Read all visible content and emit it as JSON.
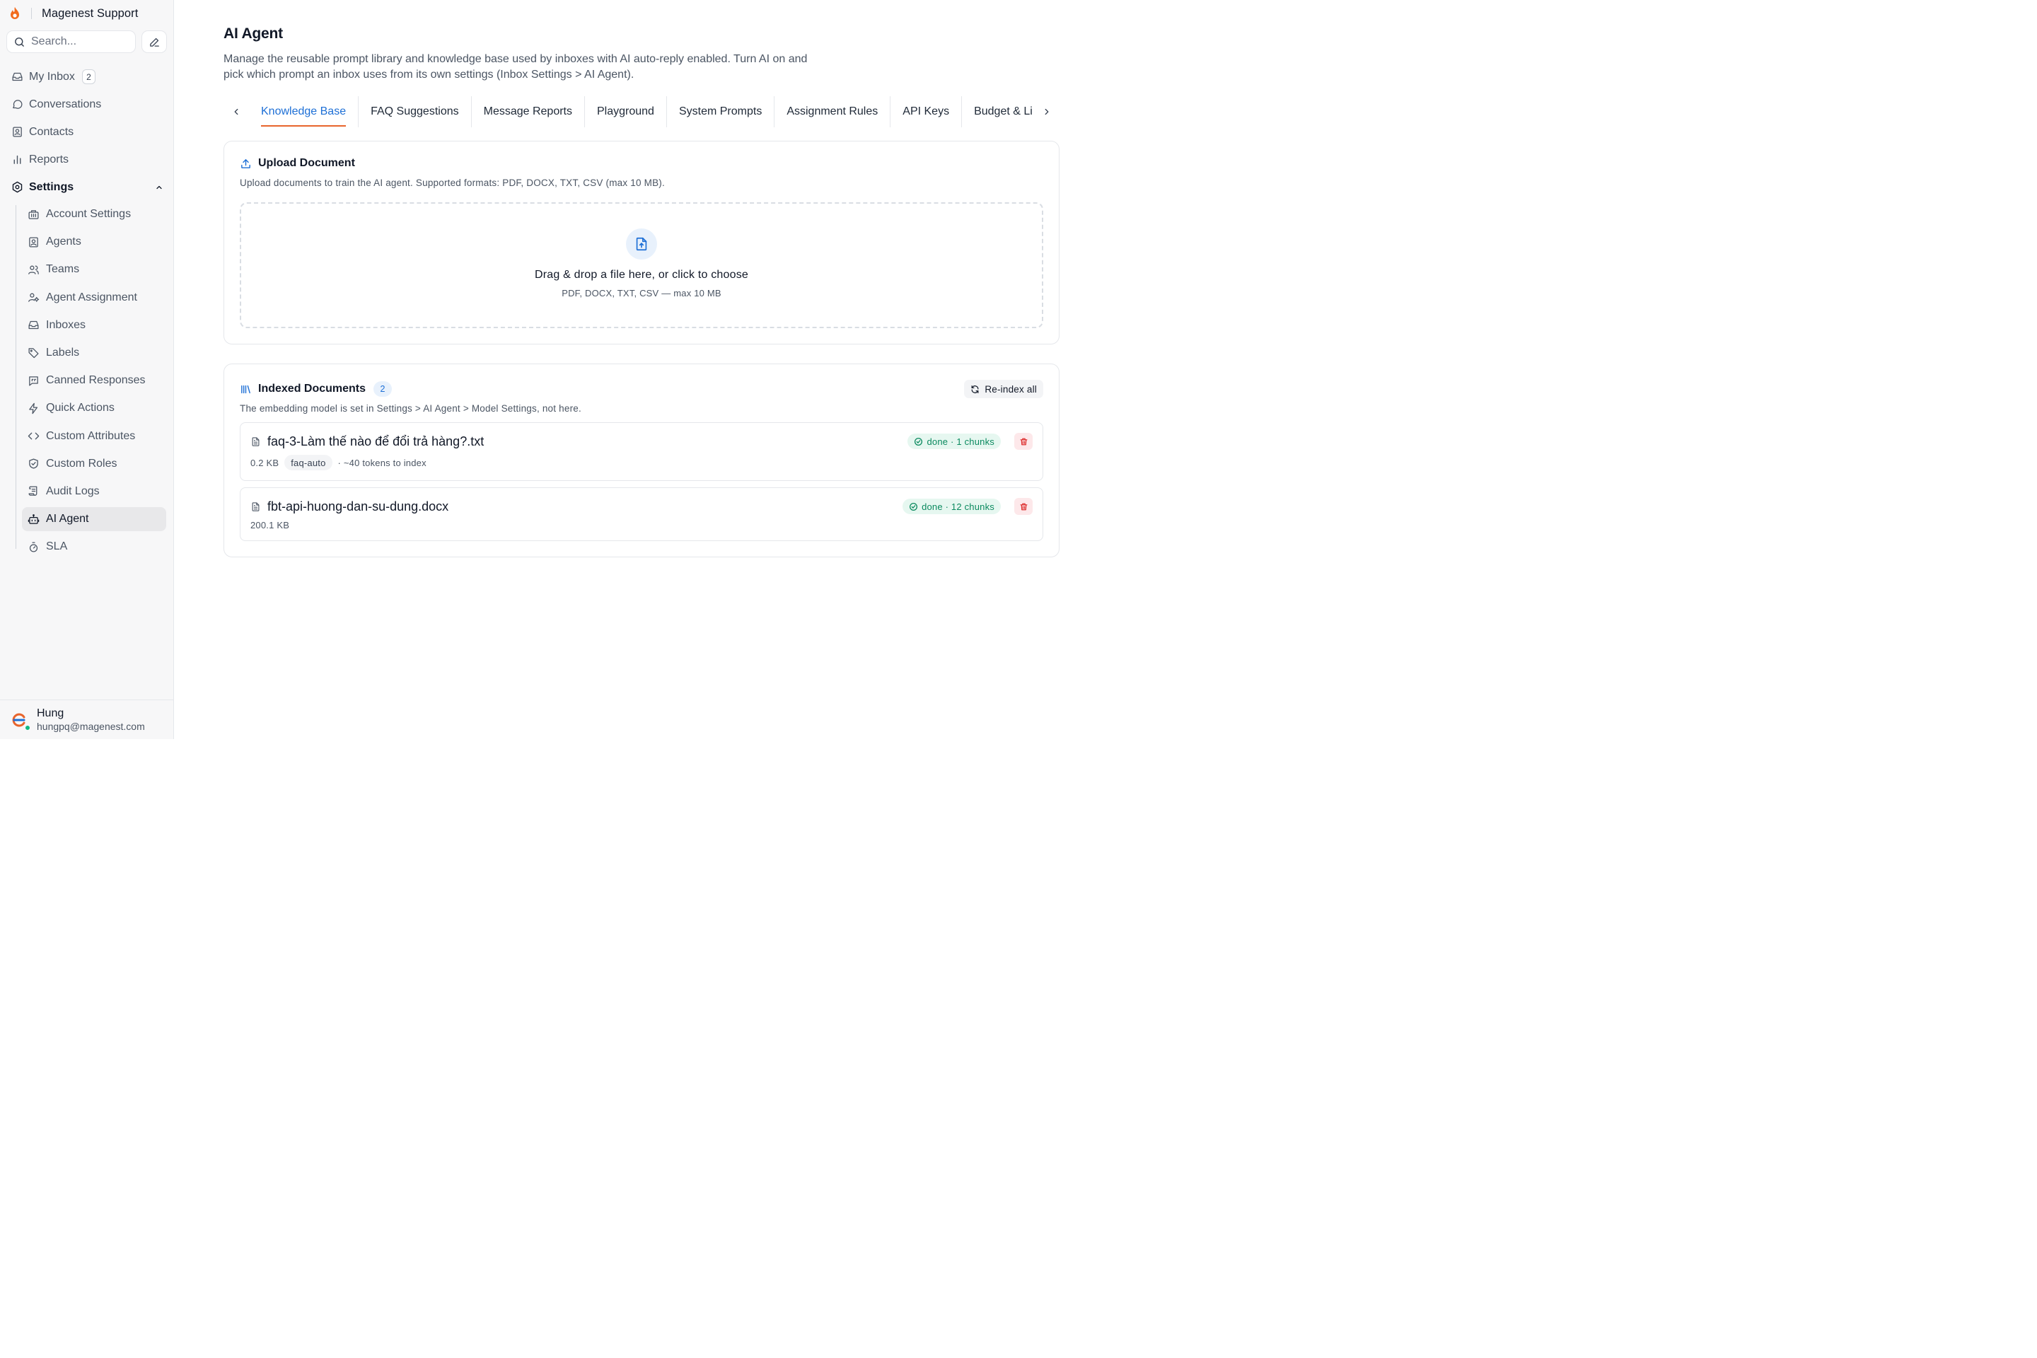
{
  "brand": {
    "name": "Magenest Support"
  },
  "search": {
    "placeholder": "Search..."
  },
  "nav": {
    "my_inbox": {
      "label": "My Inbox",
      "count": "2"
    },
    "conversations": "Conversations",
    "contacts": "Contacts",
    "reports": "Reports",
    "settings": "Settings"
  },
  "settings_items": [
    {
      "label": "Account Settings",
      "icon": "building-icon"
    },
    {
      "label": "Agents",
      "icon": "contact-card-icon"
    },
    {
      "label": "Teams",
      "icon": "users-icon"
    },
    {
      "label": "Agent Assignment",
      "icon": "user-cog-icon"
    },
    {
      "label": "Inboxes",
      "icon": "inbox-icon"
    },
    {
      "label": "Labels",
      "icon": "tag-icon"
    },
    {
      "label": "Canned Responses",
      "icon": "message-square-quote-icon"
    },
    {
      "label": "Quick Actions",
      "icon": "lightning-icon"
    },
    {
      "label": "Custom Attributes",
      "icon": "code-icon"
    },
    {
      "label": "Custom Roles",
      "icon": "shield-check-icon"
    },
    {
      "label": "Audit Logs",
      "icon": "scroll-icon"
    },
    {
      "label": "AI Agent",
      "icon": "bot-icon"
    },
    {
      "label": "SLA",
      "icon": "timer-icon"
    }
  ],
  "user": {
    "name": "Hung",
    "email": "hungpq@magenest.com"
  },
  "page": {
    "title": "AI Agent",
    "description": "Manage the reusable prompt library and knowledge base used by inboxes with AI auto-reply enabled. Turn AI on and pick which prompt an inbox uses from its own settings (Inbox Settings > AI Agent)."
  },
  "tabs": [
    "Knowledge Base",
    "FAQ Suggestions",
    "Message Reports",
    "Playground",
    "System Prompts",
    "Assignment Rules",
    "API Keys",
    "Budget & Li"
  ],
  "active_tab": "Knowledge Base",
  "upload": {
    "title": "Upload Document",
    "subtitle": "Upload documents to train the AI agent. Supported formats: PDF, DOCX, TXT, CSV (max 10 MB).",
    "drop_main": "Drag & drop a file here, or click to choose",
    "drop_sub": "PDF, DOCX, TXT, CSV — max 10 MB"
  },
  "indexed": {
    "title": "Indexed Documents",
    "count": "2",
    "reindex_label": "Re-index all",
    "note": "The embedding model is set in Settings > AI Agent > Model Settings, not here.",
    "documents": [
      {
        "name": "faq-3-Làm thế nào để đổi trả hàng?.txt",
        "size": "0.2 KB",
        "tag": "faq-auto",
        "extra": "· ~40 tokens to index",
        "status": "done · 1 chunks"
      },
      {
        "name": "fbt-api-huong-dan-su-dung.docx",
        "size": "200.1 KB",
        "status": "done · 12 chunks"
      }
    ]
  },
  "colors": {
    "accent_blue": "#1d6fd6",
    "tab_underline": "#e8642c",
    "success_green": "#0b8a5f",
    "danger_red": "#dc2626"
  }
}
